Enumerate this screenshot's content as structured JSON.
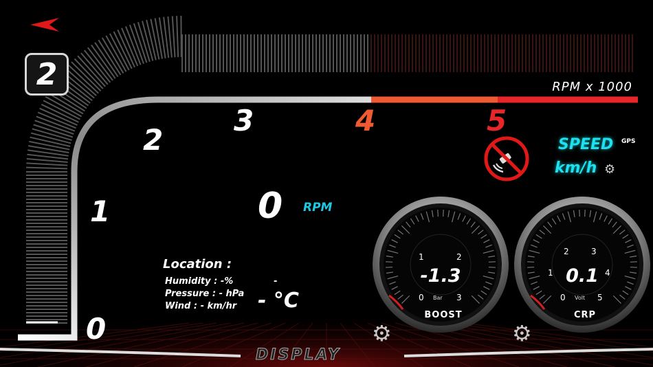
{
  "gear": "2",
  "tach": {
    "unit_label": "RPM x 1000",
    "ticks": [
      "0",
      "1",
      "2",
      "3",
      "4",
      "5"
    ]
  },
  "rpm": {
    "value": "0",
    "unit": "RPM"
  },
  "speed": {
    "title": "SPEED",
    "source": "GPS",
    "unit": "km/h"
  },
  "weather": {
    "location": "Location :",
    "humidity": "Humidity : -%",
    "pressure": "Pressure : - hPa",
    "wind": "Wind : - km/hr",
    "extra": "-",
    "temperature": "- °C"
  },
  "gauges": {
    "boost": {
      "value": "-1.3",
      "name": "BOOST",
      "unit": "Bar",
      "scale": [
        "0",
        "1",
        "2",
        "3"
      ]
    },
    "crp": {
      "value": "0.1",
      "name": "CRP",
      "unit": "Volt",
      "scale": [
        "0",
        "1",
        "2",
        "3",
        "4",
        "5"
      ]
    }
  },
  "brand": "DISPLAY",
  "icons": {
    "back": "back-arrow-icon",
    "gps_off": "gps-disabled-icon",
    "settings": "gear-icon"
  },
  "colors": {
    "accent_red": "#e8262a",
    "accent_orange": "#f05a32",
    "cyan": "#1ee0f0"
  }
}
